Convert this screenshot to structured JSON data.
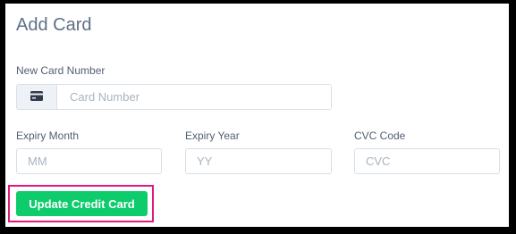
{
  "form": {
    "title": "Add Card",
    "card_number": {
      "label": "New Card Number",
      "placeholder": "Card Number",
      "icon": "credit-card-icon"
    },
    "expiry_month": {
      "label": "Expiry Month",
      "placeholder": "MM"
    },
    "expiry_year": {
      "label": "Expiry Year",
      "placeholder": "YY"
    },
    "cvc": {
      "label": "CVC Code",
      "placeholder": "CVC"
    },
    "submit_label": "Update Credit Card"
  },
  "colors": {
    "button_bg": "#0ecb6b",
    "highlight_border": "#e0197d",
    "title": "#5f6f86"
  }
}
